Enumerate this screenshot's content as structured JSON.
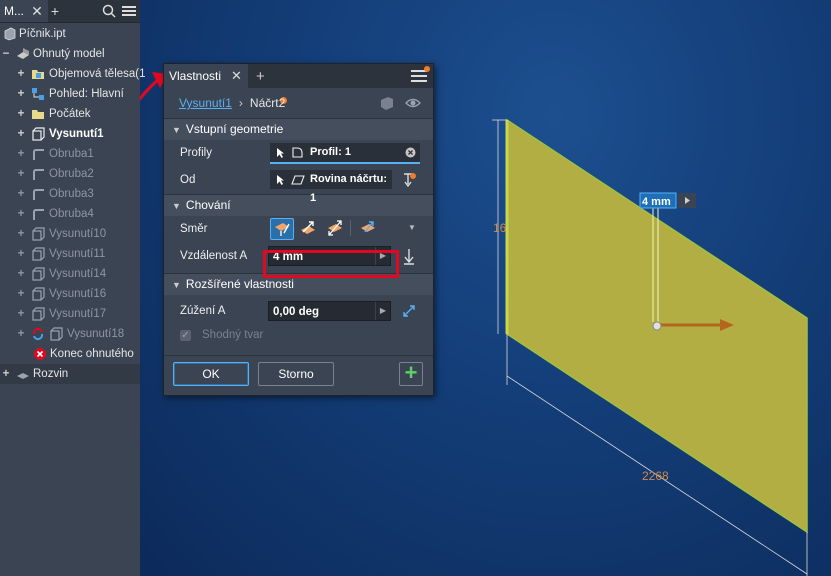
{
  "browser": {
    "tab_label": "M...",
    "items": [
      {
        "label": "Píčnik.ipt"
      },
      {
        "label": "Ohnutý model"
      },
      {
        "label": "Objemová tělesa(1"
      },
      {
        "label": "Pohled: Hlavní"
      },
      {
        "label": "Počátek"
      },
      {
        "label": "Vysunutí1"
      },
      {
        "label": "Obruba1"
      },
      {
        "label": "Obruba2"
      },
      {
        "label": "Obruba3"
      },
      {
        "label": "Obruba4"
      },
      {
        "label": "Vysunutí10"
      },
      {
        "label": "Vysunutí11"
      },
      {
        "label": "Vysunutí14"
      },
      {
        "label": "Vysunutí16"
      },
      {
        "label": "Vysunutí17"
      },
      {
        "label": "Vysunutí18"
      },
      {
        "label": "Konec ohnutého"
      },
      {
        "label": "Rozvin"
      }
    ]
  },
  "panel": {
    "tab_label": "Vlastnosti",
    "breadcrumb_link": "Vysunutí1",
    "breadcrumb_current": "Náčrt2",
    "sections": {
      "input": "Vstupní geometrie",
      "behavior": "Chování",
      "advanced": "Rozšířené vlastnosti"
    },
    "profiles_label": "Profily",
    "profiles_value": "Profil: 1",
    "from_label": "Od",
    "from_value": "Rovina náčrtu: 1",
    "direction_label": "Směr",
    "distance_label": "Vzdálenost A",
    "distance_value": "4 mm",
    "taper_label": "Zúžení A",
    "taper_value": "0,00 deg",
    "match_shape_label": "Shodný tvar",
    "ok_label": "OK",
    "cancel_label": "Storno"
  },
  "viewport": {
    "dim_label": "4 mm",
    "dim_height": "16",
    "dim_width": "2268"
  },
  "colors": {
    "accent": "#5ab0f5",
    "highlight": "#e3081f",
    "part_face": "#b3ae43",
    "dimension": "#d0894a",
    "direction_active": "#f2a46a"
  }
}
